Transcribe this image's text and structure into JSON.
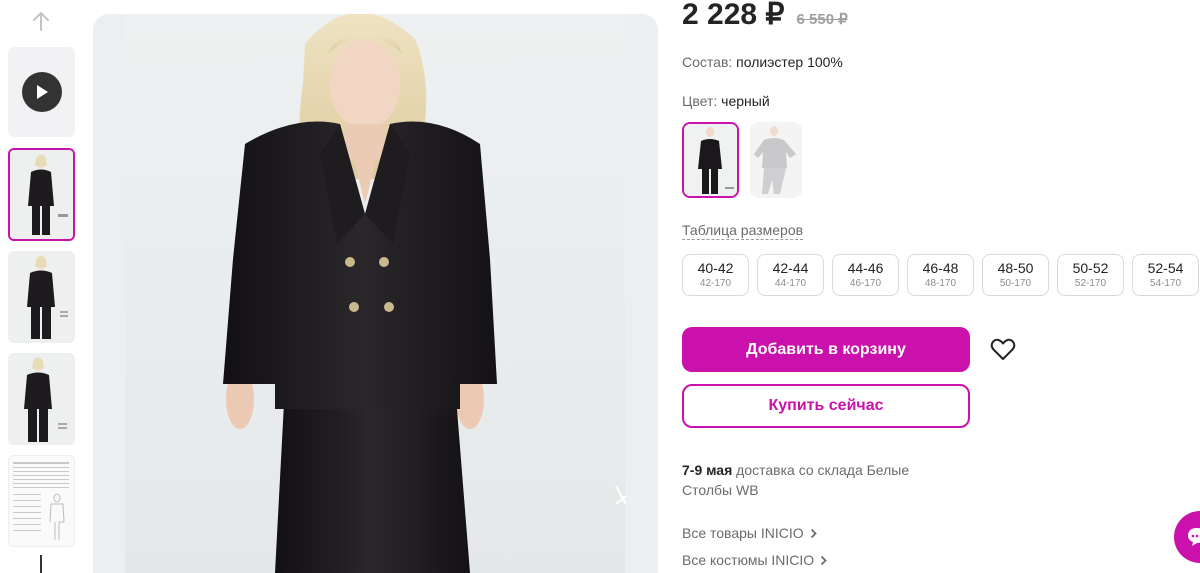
{
  "price": {
    "current": "2 228 ₽",
    "old": "6 550 ₽"
  },
  "composition": {
    "label": "Состав:",
    "value": "полиэстер 100%"
  },
  "color": {
    "label": "Цвет:",
    "value": "черный"
  },
  "size_table_link": "Таблица размеров",
  "sizes": [
    {
      "size": "40-42",
      "height": "42-170"
    },
    {
      "size": "42-44",
      "height": "44-170"
    },
    {
      "size": "44-46",
      "height": "46-170"
    },
    {
      "size": "46-48",
      "height": "48-170"
    },
    {
      "size": "48-50",
      "height": "50-170"
    },
    {
      "size": "50-52",
      "height": "52-170"
    },
    {
      "size": "52-54",
      "height": "54-170"
    }
  ],
  "buttons": {
    "add_to_cart": "Добавить в корзину",
    "buy_now": "Купить сейчас"
  },
  "delivery": {
    "date": "7-9 мая",
    "text": "доставка со склада Белые Столбы WB"
  },
  "links": {
    "all_products": "Все товары INICIO",
    "all_suits": "Все костюмы INICIO"
  },
  "colors": {
    "accent": "#cb11ab",
    "text": "#242424",
    "muted": "#6b6b6b"
  }
}
